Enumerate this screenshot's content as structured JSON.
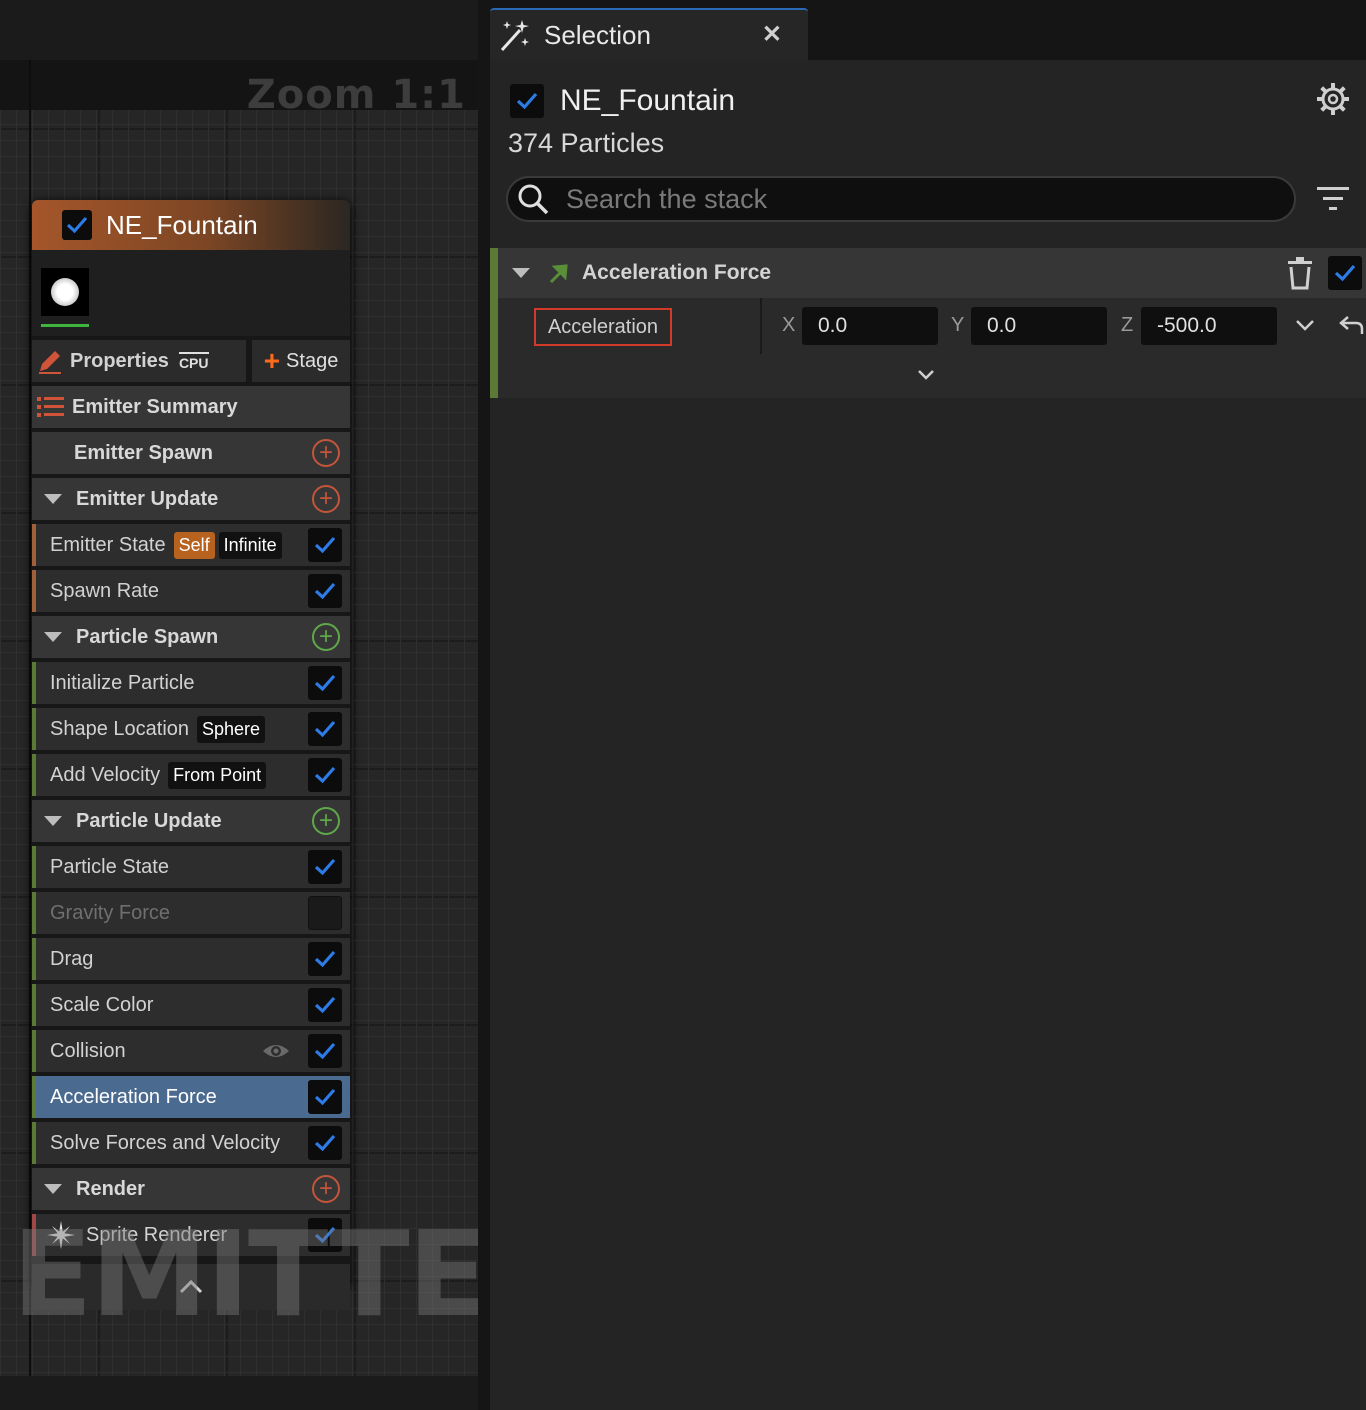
{
  "graph": {
    "zoom_label": "Zoom 1:1",
    "watermark": "EMITTER",
    "node": {
      "title": "NE_Fountain",
      "enabled": true,
      "properties_label": "Properties",
      "cpu_badge": "CPU",
      "stage_label": "Stage",
      "groups": [
        {
          "label": "Emitter Summary"
        },
        {
          "label": "Emitter Spawn"
        },
        {
          "label": "Emitter Update"
        },
        {
          "label": "Particle Spawn"
        },
        {
          "label": "Particle Update"
        },
        {
          "label": "Render"
        }
      ],
      "modules": {
        "emitter_state": {
          "label": "Emitter State",
          "tag1": "Self",
          "tag2": "Infinite"
        },
        "spawn_rate": {
          "label": "Spawn Rate"
        },
        "initialize_particle": {
          "label": "Initialize Particle"
        },
        "shape_location": {
          "label": "Shape Location",
          "tag": "Sphere"
        },
        "add_velocity": {
          "label": "Add Velocity",
          "tag": "From Point"
        },
        "particle_state": {
          "label": "Particle State"
        },
        "gravity_force": {
          "label": "Gravity Force",
          "enabled": false
        },
        "drag": {
          "label": "Drag"
        },
        "scale_color": {
          "label": "Scale Color"
        },
        "collision": {
          "label": "Collision"
        },
        "acceleration_force": {
          "label": "Acceleration Force",
          "selected": true
        },
        "solve_forces": {
          "label": "Solve Forces and Velocity"
        },
        "sprite_renderer": {
          "label": "Sprite Renderer"
        }
      }
    }
  },
  "selection_panel": {
    "tab_label": "Selection",
    "close_glyph": "✕",
    "emitter_name": "NE_Fountain",
    "particle_count": "374 Particles",
    "search": {
      "placeholder": "Search the stack",
      "value": ""
    },
    "module": {
      "title": "Acceleration Force",
      "param_name": "Acceleration",
      "x_label": "X",
      "x_value": "0.0",
      "y_label": "Y",
      "y_value": "0.0",
      "z_label": "Z",
      "z_value": "-500.0"
    }
  },
  "colors": {
    "emitter_accent": "#a5562a",
    "emitter_group_bar": "#a0603a",
    "particle_group_bar": "#5a7a36",
    "render_group_bar": "#a04848",
    "checkbox_blue": "#2d7be6",
    "selected_row": "#4b6a8f",
    "highlight_outline": "#d43a2a"
  },
  "icons": [
    "checkbox-icon",
    "pencil-icon",
    "list-icon",
    "plus-icon",
    "add-circle-icon",
    "eye-icon",
    "sparkle-icon",
    "chevron-up-icon",
    "magic-wand-icon",
    "close-icon",
    "gear-icon",
    "search-icon",
    "filter-icon",
    "trash-icon",
    "module-arrow-icon",
    "chevron-down-icon",
    "reset-arrow-icon"
  ]
}
